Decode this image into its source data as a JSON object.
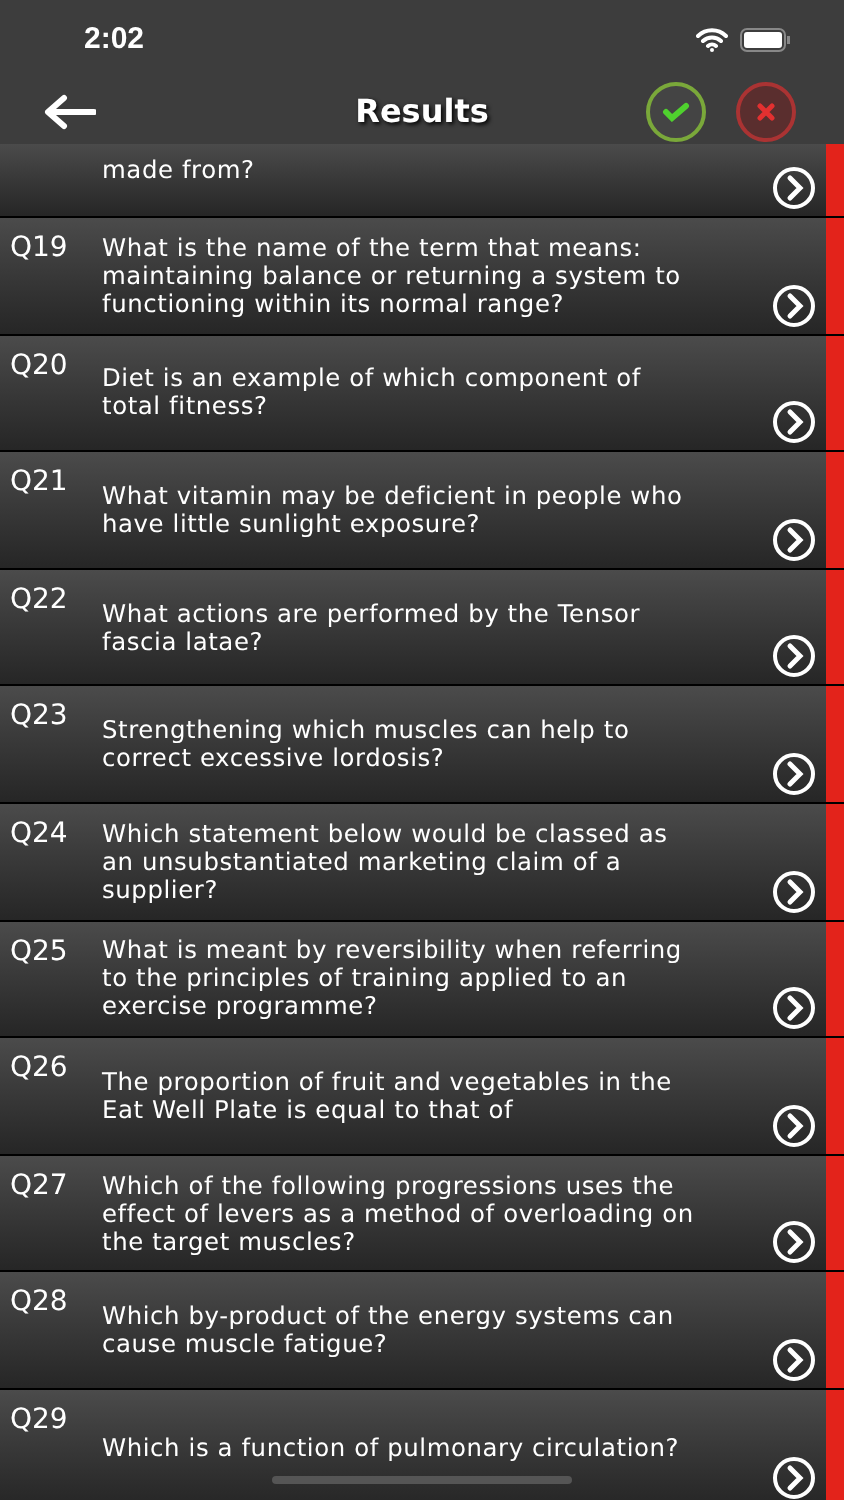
{
  "status_bar": {
    "time": "2:02"
  },
  "nav": {
    "title": "Results"
  },
  "questions": [
    {
      "kind": "partial",
      "text": "made from?",
      "correct": false
    },
    {
      "number": "Q19",
      "text": "What is the name of the term that means: maintaining balance or returning a system to functioning within its normal range?",
      "correct": false
    },
    {
      "number": "Q20",
      "text": "Diet is an example of which component of total fitness?",
      "correct": false
    },
    {
      "number": "Q21",
      "text": "What vitamin may be deficient in people who have little sunlight exposure?",
      "correct": false
    },
    {
      "number": "Q22",
      "text": "What actions are performed by the Tensor fascia latae?",
      "correct": false
    },
    {
      "number": "Q23",
      "text": "Strengthening which muscles can help to correct excessive lordosis?",
      "correct": false
    },
    {
      "number": "Q24",
      "text": "Which statement below would be classed as an unsubstantiated marketing claim of a supplier?",
      "correct": false
    },
    {
      "number": "Q25",
      "text": "What is meant by reversibility when referring to the principles of training applied to an exercise programme?",
      "correct": false
    },
    {
      "number": "Q26",
      "text": "The proportion of fruit and vegetables in the Eat Well Plate is equal to that of",
      "correct": false
    },
    {
      "number": "Q27",
      "text": "Which of the following progressions uses the effect of levers as a method of overloading on the target muscles?",
      "correct": false
    },
    {
      "number": "Q28",
      "text": "Which by-product of the energy systems can cause muscle fatigue?",
      "correct": false
    },
    {
      "number": "Q29",
      "text": "Which is a function of pulmonary circulation?",
      "correct": false
    }
  ]
}
